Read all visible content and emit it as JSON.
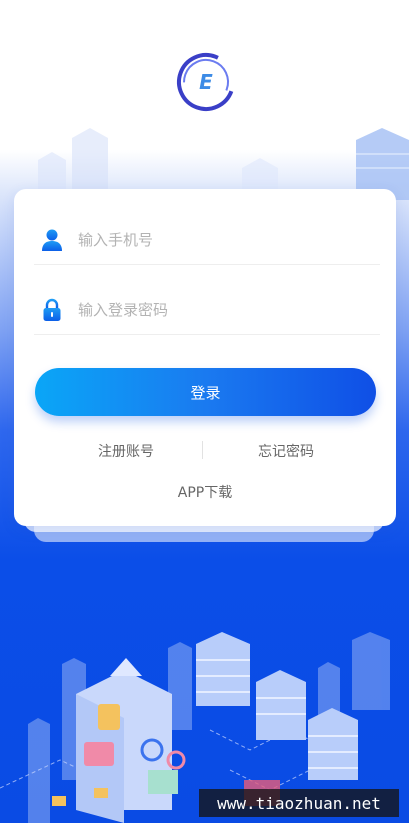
{
  "logo": {
    "letter": "E"
  },
  "form": {
    "phone_placeholder": "输入手机号",
    "password_placeholder": "输入登录密码",
    "login_label": "登录",
    "register_label": "注册账号",
    "forgot_label": "忘记密码",
    "app_download_label": "APP下载"
  },
  "watermark": {
    "text": "www.tiaozhuan.net"
  },
  "icons": [
    "user-icon",
    "lock-icon"
  ],
  "colors": {
    "accent": "#0f4fe6",
    "accent_light": "#0aa6f7",
    "background": "#0a4be4"
  }
}
